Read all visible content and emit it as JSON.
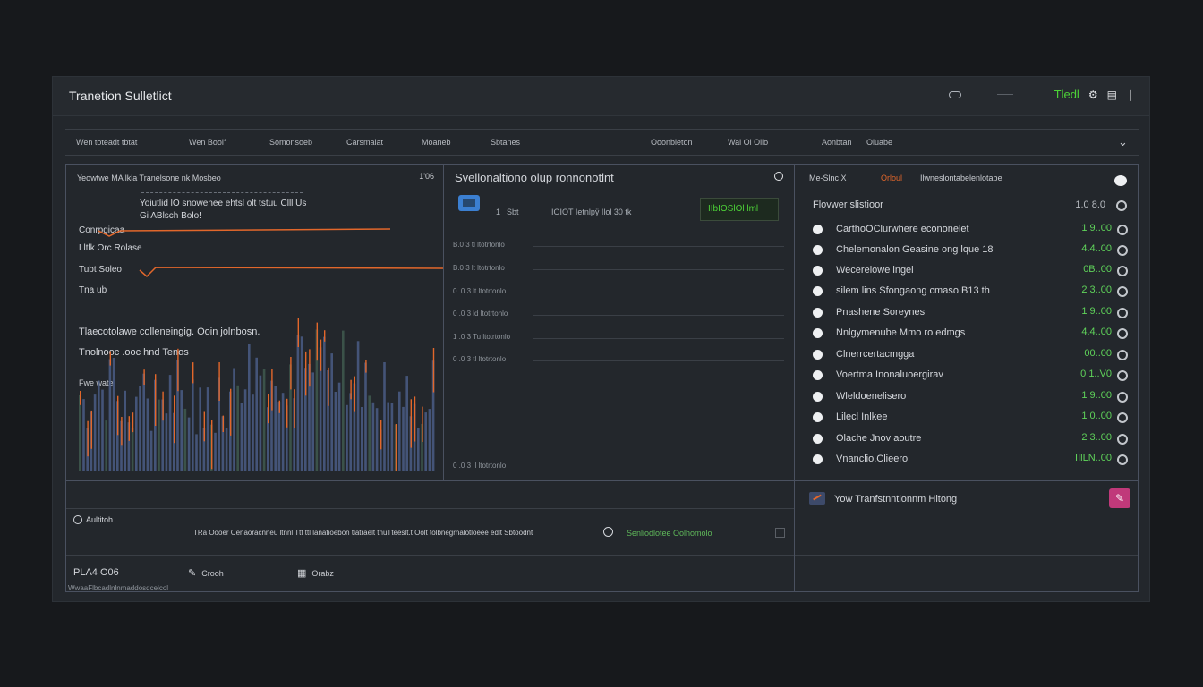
{
  "window": {
    "title": "Tranetion Sulletlict",
    "feed_label": "Tledl"
  },
  "nav": {
    "items": [
      "Wen toteadt tbtat",
      "Wen Bool°",
      "Somonsoeb",
      "Carsmalat",
      "Moaneb",
      "Sbtanes",
      "Ooonbleton",
      "Wal Ol Ollo",
      "Aonbtan",
      "Oluabe"
    ]
  },
  "left_panel": {
    "header": "Yeowtwe MA lkla Tranelsone nk Mosbeo",
    "header_right": "1'06",
    "lines": [
      "Yoiutlid lO snowenee ehtsl olt tstuu Clll Us",
      "Gi ABlsch Bolo!",
      "Conrpgicaa",
      "Lltlk Orc Rolase",
      "Tubt Soleo",
      "Tna ub",
      "Tlaecotolawe colleneingig. Ooin jolnbosn.",
      "Tnolnooc .ooc hnd Tenos",
      "Fwe wate"
    ]
  },
  "middle_panel": {
    "title": "Svellonaltiono olup ronnonotlnt",
    "row_index": "1",
    "row_code": "Sbt",
    "row_text": "IOIOT Ietnlpÿ Ilol 30 tk",
    "cta": "IIbIOSlOl lml",
    "ticks": [
      "B.0 3 tl ltotrtonlo",
      "B.0 3 lt ltotrtonlo",
      "0 .0 3 lt ltotrtonlo",
      "0 .0 3 ld ltotrtonlo",
      "1 .0 3 Tu ltotrtonlo",
      "0 .0 3 tl ltotrtonlo",
      "0 .0 3 Il ltotrtonlo"
    ]
  },
  "right_panel": {
    "header_left": "Me-Slnc X",
    "header_orange": "Orloul",
    "header_right": "Ilwneslontabelenlotabe",
    "sub_header": "Flovwer slistioor",
    "sub_header_value": "1.0 8.0",
    "items": [
      {
        "name": "CarthoOClurwhere econonelet",
        "value": "1 9..00"
      },
      {
        "name": "Chelemonalon Geasine ong lque 18",
        "value": "4.4..00"
      },
      {
        "name": "Wecerelowe ingel",
        "value": "0B..00"
      },
      {
        "name": "silem lins Sfongaong cmaso B13 th",
        "value": "2 3..00"
      },
      {
        "name": "Pnashene Soreynes",
        "value": "1 9..00"
      },
      {
        "name": "Nnlgymenube Mmo ro edmgs",
        "value": "4.4..00"
      },
      {
        "name": "Clnerrcertacmgga",
        "value": "00..00"
      },
      {
        "name": "Voertma Inonaluoergirav",
        "value": "0 1..V0"
      },
      {
        "name": "Wleldoenelisero",
        "value": "1 9..00"
      },
      {
        "name": "Lilecl Inlkee",
        "value": "1 0..00"
      },
      {
        "name": "Olache Jnov aoutre",
        "value": "2 3..00"
      },
      {
        "name": "Vnanclio.Clieero",
        "value": "IIlLN..00"
      }
    ]
  },
  "bottom_left": {
    "label": "Aultitoh",
    "description": "TRa Oooer Cenaoracnneu ltnnl Ttt ttl lanatioebon tlatraelt tnuTteeslt.t Oolt tolbnegrnalotloeee edlt Sbtoodnt",
    "status": "Senliodlotee Oolhomolo"
  },
  "footer": {
    "code": "PLA4 O06",
    "sub": "WwaaFlbcadlnlnmaddosdcelcol",
    "btn1": "Crooh",
    "btn2": "Orabz"
  },
  "bottom_right": {
    "label": "Yow Tranfstnntlonnm Hltong"
  },
  "colors": {
    "accent_green": "#4cd137",
    "accent_orange": "#e2672b",
    "bar_blue": "#4a5d86",
    "panel_border": "#4a5160"
  }
}
